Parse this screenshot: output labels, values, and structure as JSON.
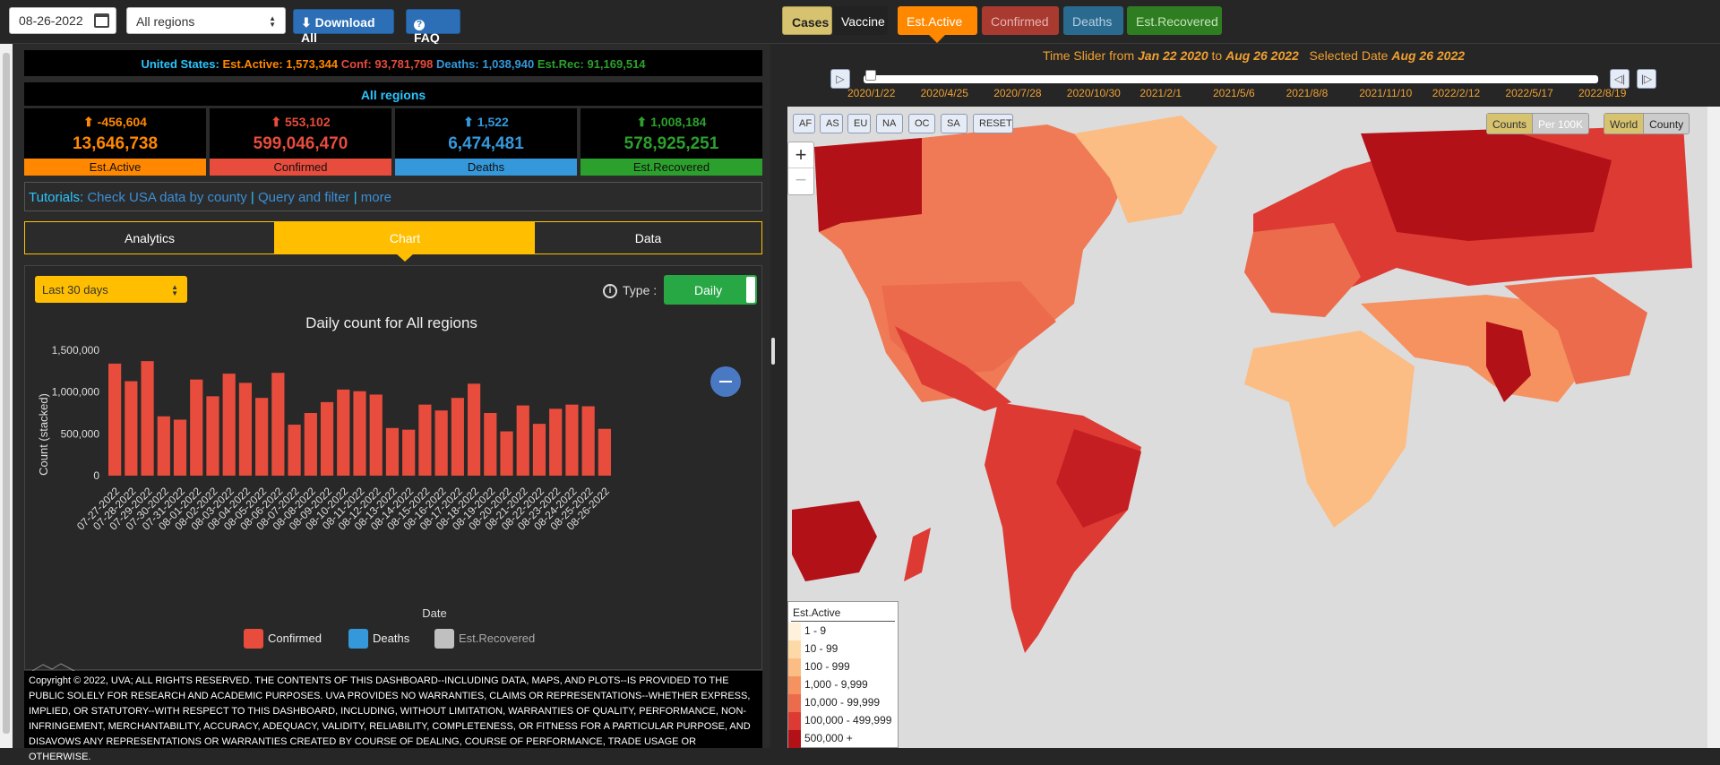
{
  "topbar": {
    "date_value": "08-26-2022",
    "region_select": "All regions",
    "download_label": "Download All",
    "faq_label": "FAQ",
    "toggle_cases": "Cases",
    "toggle_vaccine": "Vaccine",
    "metric_tabs": [
      "Est.Active",
      "Confirmed",
      "Deaths",
      "Est.Recovered"
    ]
  },
  "summary": {
    "us_label": "United States:",
    "us_active_label": "Est.Active:",
    "us_active": "1,573,344",
    "us_conf_label": "Conf:",
    "us_conf": "93,781,798",
    "us_deaths_label": "Deaths:",
    "us_deaths": "1,038,940",
    "us_rec_label": "Est.Rec:",
    "us_rec": "91,169,514",
    "region_title": "All regions"
  },
  "cards": [
    {
      "change": "-456,604",
      "total": "13,646,738",
      "label": "Est.Active",
      "color": "#ff8800"
    },
    {
      "change": "553,102",
      "total": "599,046,470",
      "label": "Confirmed",
      "color": "#e74c3c"
    },
    {
      "change": "1,522",
      "total": "6,474,481",
      "label": "Deaths",
      "color": "#3498db"
    },
    {
      "change": "1,008,184",
      "total": "578,925,251",
      "label": "Est.Recovered",
      "color": "#2ca02c"
    }
  ],
  "tutorials": {
    "label": "Tutorials:",
    "link1": "Check USA data by county",
    "link2": "Query and filter",
    "link3": "more"
  },
  "tabs": [
    "Analytics",
    "Chart",
    "Data"
  ],
  "chart_controls": {
    "period": "Last 30 days",
    "type_label": "Type :",
    "type_value": "Daily"
  },
  "chart_data": {
    "type": "bar",
    "title": "Daily count for All regions",
    "xlabel": "Date",
    "ylabel": "Count (stacked)",
    "ylim": [
      0,
      1500000
    ],
    "yticks": [
      "0",
      "500,000",
      "1,000,000",
      "1,500,000"
    ],
    "categories": [
      "07-27-2022",
      "07-28-2022",
      "07-29-2022",
      "07-30-2022",
      "07-31-2022",
      "08-01-2022",
      "08-02-2022",
      "08-03-2022",
      "08-04-2022",
      "08-05-2022",
      "08-06-2022",
      "08-07-2022",
      "08-08-2022",
      "08-09-2022",
      "08-10-2022",
      "08-11-2022",
      "08-12-2022",
      "08-13-2022",
      "08-14-2022",
      "08-15-2022",
      "08-16-2022",
      "08-17-2022",
      "08-18-2022",
      "08-19-2022",
      "08-20-2022",
      "08-21-2022",
      "08-22-2022",
      "08-23-2022",
      "08-24-2022",
      "08-25-2022",
      "08-26-2022"
    ],
    "series": [
      {
        "name": "Confirmed",
        "color": "#e74c3c",
        "values": [
          1340000,
          1130000,
          1370000,
          710000,
          670000,
          1150000,
          950000,
          1220000,
          1110000,
          930000,
          1230000,
          610000,
          750000,
          880000,
          1030000,
          1010000,
          970000,
          570000,
          550000,
          850000,
          780000,
          930000,
          1100000,
          750000,
          530000,
          840000,
          620000,
          800000,
          850000,
          830000,
          560000
        ]
      },
      {
        "name": "Deaths",
        "color": "#3498db",
        "values": []
      },
      {
        "name": "Est.Recovered",
        "color": "#c0c0c0",
        "values": []
      }
    ],
    "legend_position": "bottom",
    "grid": false
  },
  "copyright": "Copyright © 2022, UVA; ALL RIGHTS RESERVED. THE CONTENTS OF THIS DASHBOARD--INCLUDING DATA, MAPS, AND PLOTS--IS PROVIDED TO THE PUBLIC SOLELY FOR RESEARCH AND ACADEMIC PURPOSES. UVA PROVIDES NO WARRANTIES, CLAIMS OR REPRESENTATIONS--WHETHER EXPRESS, IMPLIED, OR STATUTORY--WITH RESPECT TO THIS DASHBOARD, INCLUDING, WITHOUT LIMITATION, WARRANTIES OF QUALITY, PERFORMANCE, NON-INFRINGEMENT, MERCHANTABILITY, ACCURACY, ADEQUACY, VALIDITY, RELIABILITY, COMPLETENESS, OR FITNESS FOR A PARTICULAR PURPOSE, AND DISAVOWS ANY REPRESENTATIONS OR WARRANTIES CREATED BY COURSE OF DEALING, COURSE OF PERFORMANCE, TRADE USAGE OR OTHERWISE.",
  "timeslider": {
    "prefix": "Time Slider from",
    "from": "Jan 22 2020",
    "to_word": "to",
    "to": "Aug 26 2022",
    "selected_label": "Selected Date",
    "selected": "Aug 26 2022",
    "ticks": [
      "2020/1/22",
      "2020/4/25",
      "2020/7/28",
      "2020/10/30",
      "2021/2/1",
      "2021/5/6",
      "2021/8/8",
      "2021/11/10",
      "2022/2/12",
      "2022/5/17",
      "2022/8/19"
    ],
    "position": 1.0
  },
  "map": {
    "region_buttons": [
      "AF",
      "AS",
      "EU",
      "NA",
      "OC",
      "SA",
      "RESET"
    ],
    "zoom_in": "+",
    "zoom_out": "−",
    "toggle1": [
      "Counts",
      "Per 100K"
    ],
    "toggle2": [
      "World",
      "County"
    ],
    "legend_title": "Est.Active",
    "legend": [
      {
        "label": "1 - 9",
        "color": "#fff1dc"
      },
      {
        "label": "10 - 99",
        "color": "#fdd9a8"
      },
      {
        "label": "100 - 999",
        "color": "#fbbd84"
      },
      {
        "label": "1,000 - 9,999",
        "color": "#f69260"
      },
      {
        "label": "10,000 - 99,999",
        "color": "#ec6b4c"
      },
      {
        "label": "100,000 - 499,999",
        "color": "#dd3a33"
      },
      {
        "label": "500,000 +",
        "color": "#b31118"
      }
    ]
  }
}
